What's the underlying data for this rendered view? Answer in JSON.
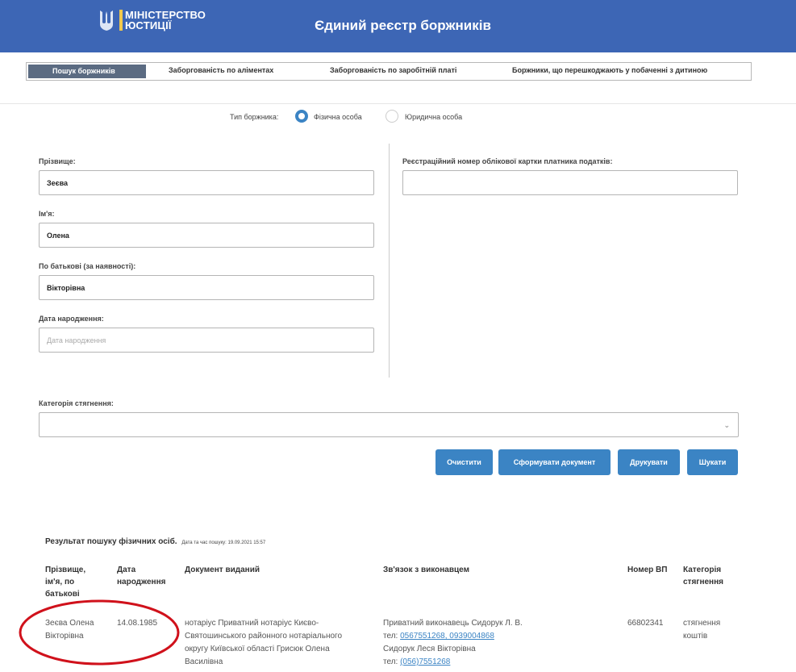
{
  "header": {
    "logo_line1": "МІНІСТЕРСТВО",
    "logo_line2": "ЮСТИЦІЇ",
    "title": "Єдиний реєстр боржників"
  },
  "tabs": [
    {
      "label": "Пошук боржників",
      "active": true
    },
    {
      "label": "Заборгованість по аліментах",
      "active": false
    },
    {
      "label": "Заборгованість по заробітній платі",
      "active": false
    },
    {
      "label": "Боржники, що перешкоджають у побаченні з дитиною",
      "active": false
    }
  ],
  "debtor_type": {
    "label": "Тип боржника:",
    "options": [
      "Фізична особа",
      "Юридична особа"
    ],
    "selected": "Фізична особа"
  },
  "form": {
    "surname_label": "Прізвище:",
    "surname_value": "Зеєва",
    "name_label": "Ім'я:",
    "name_value": "Олена",
    "patronymic_label": "По батькові (за наявності):",
    "patronymic_value": "Вікторівна",
    "birthdate_label": "Дата народження:",
    "birthdate_placeholder": "Дата народження",
    "tax_label": "Реєстраційний номер облікової картки платника податків:",
    "tax_value": "",
    "category_label": "Категорія стягнення:",
    "category_value": ""
  },
  "buttons": {
    "clear": "Очистити",
    "generate": "Сформувати документ",
    "print": "Друкувати",
    "search": "Шукати"
  },
  "results": {
    "title": "Результат пошуку фізичних осіб.",
    "search_time": "Дата та час пошуку: 19.09.2021 15:57",
    "columns": [
      "Прізвище, ім'я, по батькові",
      "Дата народження",
      "Документ виданий",
      "Зв'язок з виконавцем",
      "Номер ВП",
      "Категорія стягнення"
    ],
    "rows": [
      {
        "name": "Зеєва Олена Вікторівна",
        "birthdate": "14.08.1985",
        "document": "нотаріус Приватний нотаріус Києво-Святошинського районного нотаріального округу Київської області Грисюк Олена Василівна",
        "contact_executor": "Приватний виконавець Сидорук Л. В.",
        "contact_phone_prefix": "тел:",
        "contact_phones": "0567551268, 0939004868",
        "contact_person": "Сидорук Леся Вікторівна",
        "contact_phone2_prefix": "тел:",
        "contact_phone2": "(056)7551268",
        "vp_number": "66802341",
        "category": "стягнення коштів"
      }
    ]
  },
  "colors": {
    "header_bg": "#3d66b5",
    "accent": "#3b84c4",
    "active_tab": "#5b6b82",
    "highlight_circle": "#d0111b"
  }
}
